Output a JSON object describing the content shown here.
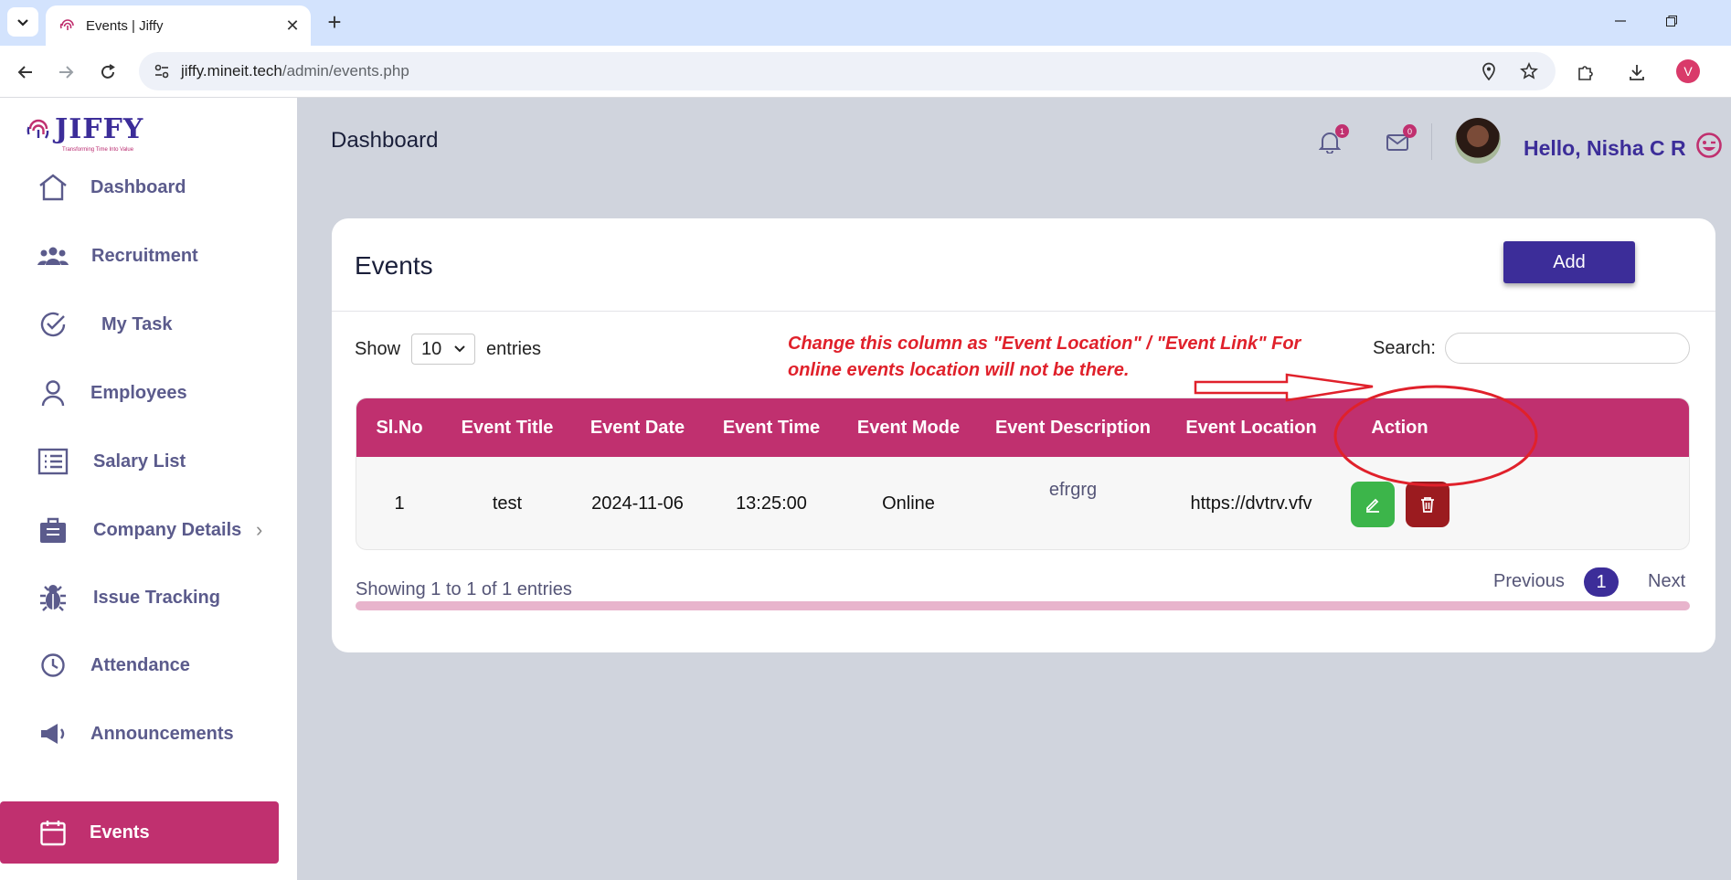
{
  "browser": {
    "tab_title": "Events | Jiffy",
    "url_host": "jiffy.mineit.tech",
    "url_path": "/admin/events.php",
    "profile_initial": "V"
  },
  "sidebar": {
    "logo_text": "JIFFY",
    "logo_tagline": "Transforming Time Into Value",
    "items": [
      {
        "label": "Dashboard",
        "icon": "home-icon"
      },
      {
        "label": "Recruitment",
        "icon": "users-icon"
      },
      {
        "label": "My Task",
        "icon": "check-circle-icon"
      },
      {
        "label": "Employees",
        "icon": "person-icon"
      },
      {
        "label": "Salary List",
        "icon": "list-icon"
      },
      {
        "label": "Company Details",
        "icon": "briefcase-icon"
      },
      {
        "label": "Issue Tracking",
        "icon": "bug-icon"
      },
      {
        "label": "Attendance",
        "icon": "clock-icon"
      },
      {
        "label": "Announcements",
        "icon": "megaphone-icon"
      },
      {
        "label": "Events",
        "icon": "calendar-icon"
      }
    ],
    "active_item": "Events"
  },
  "header": {
    "title": "Dashboard",
    "notifications_count": "1",
    "messages_count": "0",
    "greeting": "Hello, Nisha C R"
  },
  "card": {
    "title": "Events",
    "add_label": "Add",
    "show_label": "Show",
    "entries_value": "10",
    "entries_label": "entries",
    "search_label": "Search:",
    "search_value": "",
    "columns": [
      "Sl.No",
      "Event Title",
      "Event Date",
      "Event Time",
      "Event Mode",
      "Event Description",
      "Event Location",
      "Action"
    ],
    "rows": [
      {
        "sl_no": "1",
        "title": "test",
        "date": "2024-11-06",
        "time": "13:25:00",
        "mode": "Online",
        "description": "efrgrg",
        "location": "https://dvtrv.vfv"
      }
    ],
    "info": "Showing 1 to 1 of 1 entries",
    "prev_label": "Previous",
    "current_page": "1",
    "next_label": "Next"
  },
  "annotation": {
    "line1": "Change this column as \"Event Location\" / \"Event Link\" For",
    "line2": "online events location will not be there.",
    "color": "#e0212b"
  },
  "colors": {
    "brand_primary": "#3c2d99",
    "brand_accent": "#c0306f",
    "edit_green": "#3cb54a",
    "delete_red": "#9b1b1f"
  }
}
